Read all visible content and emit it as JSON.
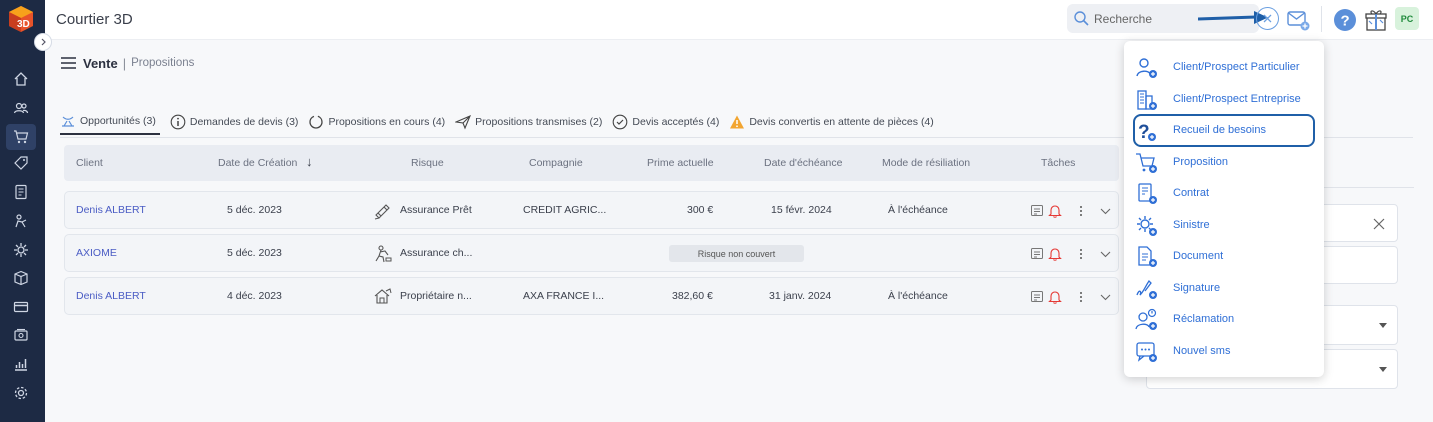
{
  "app": {
    "title": "Courtier 3D"
  },
  "search": {
    "placeholder": "Recherche"
  },
  "user": {
    "initials": "PC"
  },
  "breadcrumb": {
    "section": "Vente",
    "separator": "|",
    "page": "Propositions"
  },
  "tabs": [
    {
      "label": "Opportunités (3)",
      "icon": "opportunity-icon",
      "active": true
    },
    {
      "label": "Demandes de devis (3)",
      "icon": "info-icon"
    },
    {
      "label": "Propositions en cours (4)",
      "icon": "progress-icon"
    },
    {
      "label": "Propositions transmises (2)",
      "icon": "send-icon"
    },
    {
      "label": "Devis acceptés (4)",
      "icon": "check-circle-icon"
    },
    {
      "label": "Devis convertis en attente de pièces (4)",
      "icon": "warning-icon"
    }
  ],
  "table": {
    "headers": {
      "client": "Client",
      "date": "Date de Création",
      "sort": "↓",
      "risk": "Risque",
      "company": "Compagnie",
      "premium": "Prime actuelle",
      "due": "Date d'échéance",
      "termination": "Mode de résiliation",
      "tasks": "Tâches"
    },
    "rows": [
      {
        "client": "Denis ALBERT",
        "date": "5 déc. 2023",
        "risk": "Assurance Prêt",
        "risk_icon": "loan-icon",
        "company": "CREDIT AGRIC...",
        "premium": "300 €",
        "due": "15 févr. 2024",
        "termination": "À l'échéance",
        "badge": ""
      },
      {
        "client": "AXIOME",
        "date": "5 déc. 2023",
        "risk": "Assurance ch...",
        "risk_icon": "worker-icon",
        "company": "",
        "premium": "",
        "due": "",
        "termination": "",
        "badge": "Risque non couvert"
      },
      {
        "client": "Denis ALBERT",
        "date": "4 déc. 2023",
        "risk": "Propriétaire n...",
        "risk_icon": "owner-icon",
        "company": "AXA FRANCE I...",
        "premium": "382,60 €",
        "due": "31 janv. 2024",
        "termination": "À l'échéance",
        "badge": ""
      }
    ]
  },
  "dropdown": {
    "items": [
      {
        "label": "Client/Prospect Particulier",
        "icon": "person-add-icon"
      },
      {
        "label": "Client/Prospect Entreprise",
        "icon": "building-add-icon"
      },
      {
        "label": "Recueil de besoins",
        "icon": "question-add-icon",
        "highlighted": true
      },
      {
        "label": "Proposition",
        "icon": "cart-add-icon"
      },
      {
        "label": "Contrat",
        "icon": "contract-add-icon"
      },
      {
        "label": "Sinistre",
        "icon": "claim-add-icon"
      },
      {
        "label": "Document",
        "icon": "document-add-icon"
      },
      {
        "label": "Signature",
        "icon": "signature-add-icon"
      },
      {
        "label": "Réclamation",
        "icon": "complaint-add-icon"
      },
      {
        "label": "Nouvel sms",
        "icon": "sms-add-icon"
      }
    ]
  },
  "colors": {
    "sidebar": "#1d2a44",
    "accent": "#2f6fd6",
    "highlight": "#1f5fa8",
    "alert": "#e53935"
  }
}
